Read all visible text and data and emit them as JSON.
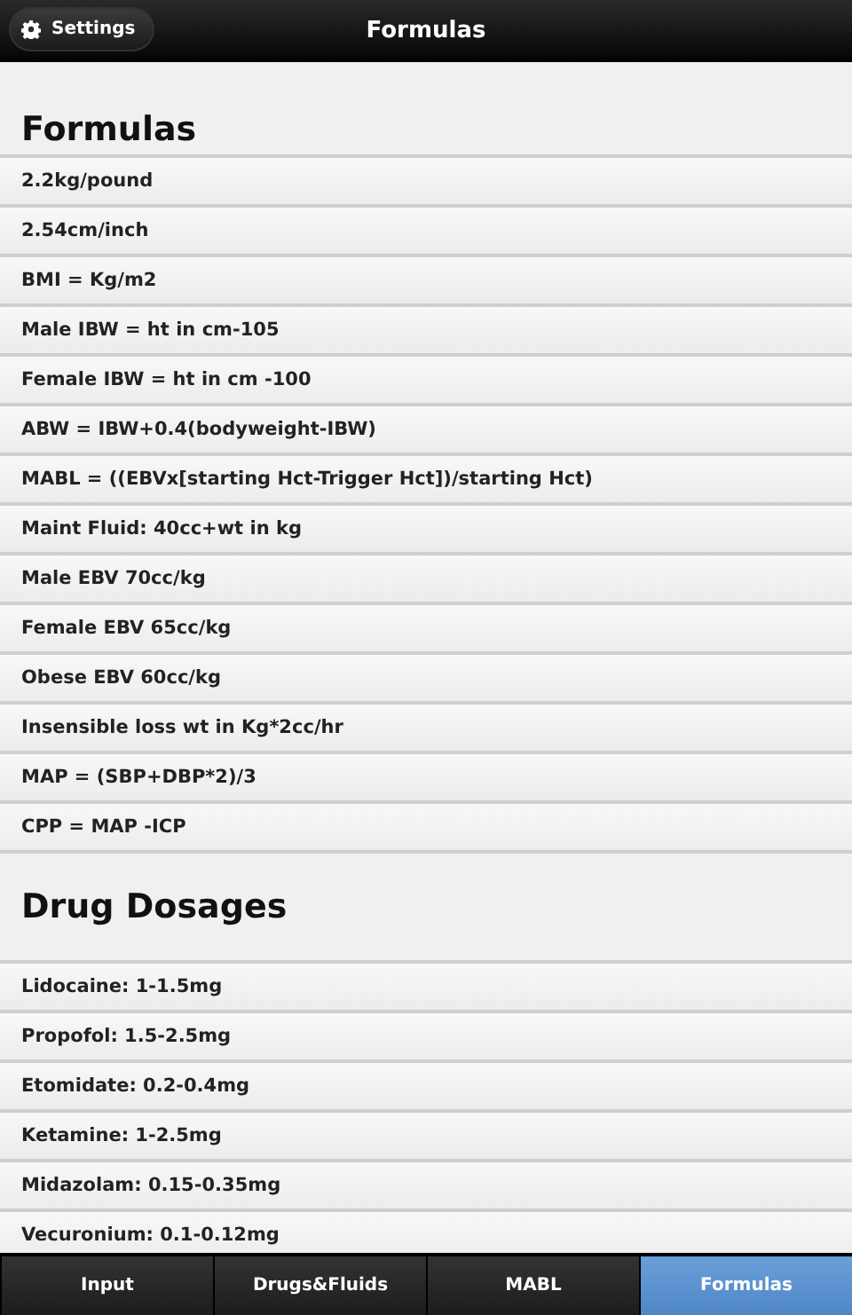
{
  "header": {
    "back_button": "Settings",
    "title": "Formulas"
  },
  "sections": [
    {
      "heading": "Formulas",
      "rows": [
        "2.2kg/pound",
        "2.54cm/inch",
        "BMI = Kg/m2",
        "Male IBW = ht in cm-105",
        "Female IBW = ht in cm -100",
        "ABW = IBW+0.4(bodyweight-IBW)",
        "MABL = ((EBVx[starting Hct-Trigger Hct])/starting Hct)",
        "Maint Fluid: 40cc+wt in kg",
        "Male EBV 70cc/kg",
        "Female EBV 65cc/kg",
        "Obese EBV 60cc/kg",
        "Insensible loss wt in Kg*2cc/hr",
        "MAP = (SBP+DBP*2)/3",
        "CPP = MAP -ICP"
      ]
    },
    {
      "heading": "Drug Dosages",
      "rows": [
        "Lidocaine: 1-1.5mg",
        "Propofol: 1.5-2.5mg",
        "Etomidate: 0.2-0.4mg",
        "Ketamine: 1-2.5mg",
        "Midazolam: 0.15-0.35mg",
        "Vecuronium: 0.1-0.12mg"
      ]
    }
  ],
  "tabs": [
    {
      "label": "Input",
      "selected": false
    },
    {
      "label": "Drugs&Fluids",
      "selected": false
    },
    {
      "label": "MABL",
      "selected": false
    },
    {
      "label": "Formulas",
      "selected": true
    }
  ]
}
